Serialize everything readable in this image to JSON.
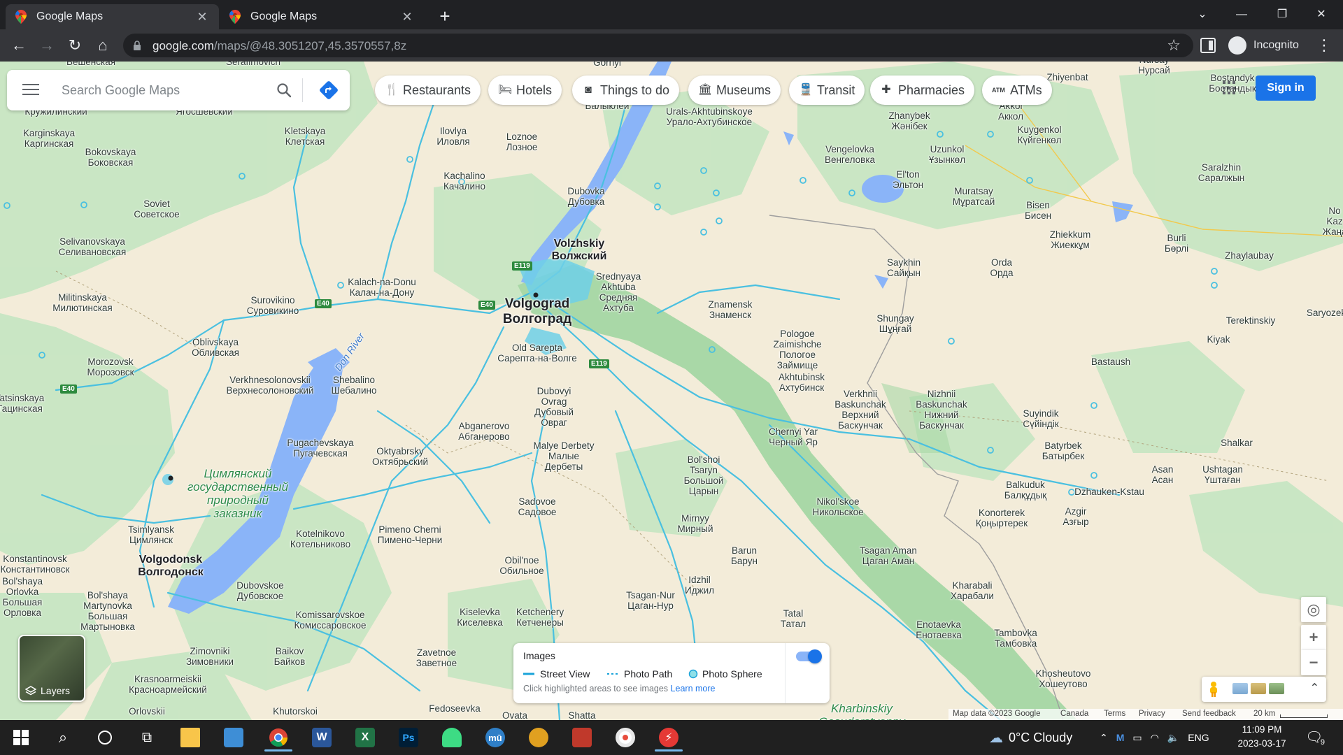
{
  "browser": {
    "tabs": [
      {
        "title": "Google Maps",
        "active": true
      },
      {
        "title": "Google Maps",
        "active": false
      }
    ],
    "new_tab_label": "+",
    "url_host": "google.com",
    "url_path": "/maps/@48.3051207,45.3570557,8z",
    "profile_label": "Incognito"
  },
  "maps": {
    "search_placeholder": "Search Google Maps",
    "chips": [
      {
        "label": "Restaurants",
        "icon": "restaurant-icon"
      },
      {
        "label": "Hotels",
        "icon": "hotel-icon"
      },
      {
        "label": "Things to do",
        "icon": "camera-icon"
      },
      {
        "label": "Museums",
        "icon": "museum-icon"
      },
      {
        "label": "Transit",
        "icon": "transit-icon"
      },
      {
        "label": "Pharmacies",
        "icon": "pharmacy-icon"
      },
      {
        "label": "ATMs",
        "icon": "atm-icon"
      }
    ],
    "signin_label": "Sign in",
    "layers_label": "Layers",
    "zoom_in": "+",
    "zoom_out": "−",
    "images_panel": {
      "title": "Images",
      "street_view": "Street View",
      "photo_path": "Photo Path",
      "photo_sphere": "Photo Sphere",
      "hint": "Click highlighted areas to see images",
      "learn_more": "Learn more",
      "toggle_on": true
    },
    "attribution": {
      "map_data": "Map data ©2023 Google",
      "country": "Canada",
      "terms": "Terms",
      "privacy": "Privacy",
      "feedback": "Send feedback",
      "scale": "20 km"
    },
    "places": [
      {
        "t": "Вешенская",
        "cls": ""
      },
      {
        "t": "Serafimovich",
        "cls": ""
      },
      {
        "t": "Gornyi",
        "cls": ""
      },
      {
        "t": "Nursay\nНурсай",
        "cls": ""
      },
      {
        "t": "Zhiyenbat",
        "cls": ""
      },
      {
        "t": "Bostandyk\nБостандык",
        "cls": ""
      },
      {
        "t": "Кружилинский",
        "cls": ""
      },
      {
        "t": "Ягосшевский",
        "cls": ""
      },
      {
        "t": "Балыклей",
        "cls": ""
      },
      {
        "t": "Urals-Akhtubinskoye\nУрало-Ахтубинское",
        "cls": ""
      },
      {
        "t": "Akkol\nАккол",
        "cls": ""
      },
      {
        "t": "Karginskaya\nКаргинская",
        "cls": ""
      },
      {
        "t": "Kletskaya\nКлетская",
        "cls": ""
      },
      {
        "t": "Ilovlya\nИловля",
        "cls": ""
      },
      {
        "t": "Loznoe\nЛозное",
        "cls": ""
      },
      {
        "t": "Zhanybek\nЖәнібек",
        "cls": ""
      },
      {
        "t": "Kuygenkol\nКүйгенкөл",
        "cls": ""
      },
      {
        "t": "Bokovskaya\nБоковская",
        "cls": ""
      },
      {
        "t": "Kachalino\nКачалино",
        "cls": ""
      },
      {
        "t": "Vengelovka\nВенгеловка",
        "cls": ""
      },
      {
        "t": "Uzunkol\nҰзынкөл",
        "cls": ""
      },
      {
        "t": "El'ton\nЭльтон",
        "cls": ""
      },
      {
        "t": "Saralzhin\nСаралжын",
        "cls": ""
      },
      {
        "t": "Dubovka\nДубовка",
        "cls": ""
      },
      {
        "t": "Muratsay\nМұратсай",
        "cls": ""
      },
      {
        "t": "Bisen\nБисен",
        "cls": ""
      },
      {
        "t": "Soviet\nСоветское",
        "cls": ""
      },
      {
        "t": "Zhiekkum\nЖиеккұм",
        "cls": ""
      },
      {
        "t": "Burli\nБөрлі",
        "cls": ""
      },
      {
        "t": "Zhaylaubay",
        "cls": ""
      },
      {
        "t": "Selivanovskaya\nСеливановская",
        "cls": ""
      },
      {
        "t": "Volzhskiy\nВолжский",
        "cls": "medium"
      },
      {
        "t": "Saykhin\nСайқын",
        "cls": ""
      },
      {
        "t": "Orda\nОрда",
        "cls": ""
      },
      {
        "t": "Kalach-na-Donu\nКалач-на-Дону",
        "cls": ""
      },
      {
        "t": "Srednyaya\nAkhtuba\nСредняя\nАхтуба",
        "cls": ""
      },
      {
        "t": "Militinskaya\nМилютинская",
        "cls": ""
      },
      {
        "t": "Surovikino\nСуровикино",
        "cls": ""
      },
      {
        "t": "Volgograd\nВолгоград",
        "cls": "major"
      },
      {
        "t": "Znamensk\nЗнаменск",
        "cls": ""
      },
      {
        "t": "Shungay\nШұңғай",
        "cls": ""
      },
      {
        "t": "Terektinskiy",
        "cls": ""
      },
      {
        "t": "Saryozek",
        "cls": ""
      },
      {
        "t": "Oblivskaya\nОбливская",
        "cls": ""
      },
      {
        "t": "Pologoe\nZaimishche\nПологое\nЗаймище",
        "cls": ""
      },
      {
        "t": "Kiyak",
        "cls": ""
      },
      {
        "t": "Morozovsk\nМорозовск",
        "cls": ""
      },
      {
        "t": "Old Sarepta\nСарепта-на-Волге",
        "cls": ""
      },
      {
        "t": "Bastaush",
        "cls": ""
      },
      {
        "t": "Verkhnesolonovskii\nВерхнесолоновский",
        "cls": ""
      },
      {
        "t": "Shebalino\nШебалино",
        "cls": ""
      },
      {
        "t": "Akhtubinsk\nАхтубинск",
        "cls": ""
      },
      {
        "t": "Dubovyi\nOvrag\nДубовый\nОвраг",
        "cls": ""
      },
      {
        "t": "Verkhnii\nBaskunchak\nВерхний\nБаскунчак",
        "cls": ""
      },
      {
        "t": "Nizhnii\nBaskunchak\nНижний\nБаскунчак",
        "cls": ""
      },
      {
        "t": "Tatsinskaya\nТацинская",
        "cls": ""
      },
      {
        "t": "Suyindik\nСүйіндік",
        "cls": ""
      },
      {
        "t": "Abganerovo\nАбганерово",
        "cls": ""
      },
      {
        "t": "Pugachevskaya\nПугачевская",
        "cls": ""
      },
      {
        "t": "Oktyabrsky\nОктябрьский",
        "cls": ""
      },
      {
        "t": "Chernyi Yar\nЧерный Яр",
        "cls": ""
      },
      {
        "t": "Batyrbek\nБатырбек",
        "cls": ""
      },
      {
        "t": "Shalkar",
        "cls": ""
      },
      {
        "t": "Malye Derbety\nМалые\nДербеты",
        "cls": ""
      },
      {
        "t": "Bol'shoi\nTsaryn\nБольшой\nЦарын",
        "cls": ""
      },
      {
        "t": "Asan\nАсан",
        "cls": ""
      },
      {
        "t": "Ushtagan\nҮштаған",
        "cls": ""
      },
      {
        "t": "Balkuduk\nБалқұдық",
        "cls": ""
      },
      {
        "t": "Dzhauken-Kstau",
        "cls": ""
      },
      {
        "t": "Sadovoe\nСадовое",
        "cls": ""
      },
      {
        "t": "Nikol'skoe\nНикольское",
        "cls": ""
      },
      {
        "t": "Konorterek\nҚоңыртерек",
        "cls": ""
      },
      {
        "t": "Azgir\nАзғыр",
        "cls": ""
      },
      {
        "t": "Tsimlyansk\nЦимлянск",
        "cls": ""
      },
      {
        "t": "Kotelnikovo\nКотельниково",
        "cls": ""
      },
      {
        "t": "Pimeno Cherni\nПимено-Черни",
        "cls": ""
      },
      {
        "t": "Mirnyy\nМирный",
        "cls": ""
      },
      {
        "t": "Konstantinovsk\nКонстантиновск",
        "cls": ""
      },
      {
        "t": "Volgodonsk\nВолгодонск",
        "cls": "medium"
      },
      {
        "t": "Obil'noe\nОбильное",
        "cls": ""
      },
      {
        "t": "Barun\nБарун",
        "cls": ""
      },
      {
        "t": "Tsagan Aman\nЦаган Аман",
        "cls": ""
      },
      {
        "t": "Bol'shaya\nOrlovka\nБольшая\nОрловка",
        "cls": ""
      },
      {
        "t": "Dubovskoe\nДубовское",
        "cls": ""
      },
      {
        "t": "Idzhil\nИджил",
        "cls": ""
      },
      {
        "t": "Kharabali\nХарабали",
        "cls": ""
      },
      {
        "t": "Bol'shaya\nMartynovka\nБольшая\nМартыновка",
        "cls": ""
      },
      {
        "t": "Tsagan-Nur\nЦаган-Нур",
        "cls": ""
      },
      {
        "t": "Komissarovskoe\nКомиссаровское",
        "cls": ""
      },
      {
        "t": "Kiselevka\nКиселевка",
        "cls": ""
      },
      {
        "t": "Ketchenery\nКетченеры",
        "cls": ""
      },
      {
        "t": "Tatal\nТатал",
        "cls": ""
      },
      {
        "t": "Enotaevka\nЕнотаевка",
        "cls": ""
      },
      {
        "t": "Tambovka\nТамбовка",
        "cls": ""
      },
      {
        "t": "Zimovniki\nЗимовники",
        "cls": ""
      },
      {
        "t": "Baikov\nБайков",
        "cls": ""
      },
      {
        "t": "Zavetnoe\nЗаветное",
        "cls": ""
      },
      {
        "t": "Krasnoarmeiskii\nКрасноармейский",
        "cls": ""
      },
      {
        "t": "Khosheutovo\nХошеутово",
        "cls": ""
      },
      {
        "t": "Orlovskii",
        "cls": ""
      },
      {
        "t": "Khutorskoi",
        "cls": ""
      },
      {
        "t": "Fedoseevka",
        "cls": ""
      },
      {
        "t": "Ovata",
        "cls": ""
      },
      {
        "t": "Shatta",
        "cls": ""
      },
      {
        "t": "Don River",
        "cls": "water"
      },
      {
        "t": "Цимлянский\nгосударственный\nприродный\nзаказник",
        "cls": "park"
      },
      {
        "t": "Kharbinskiy\nGosudarstvenny",
        "cls": "park"
      },
      {
        "t": "No\nKaz\nЖаңа",
        "cls": ""
      }
    ],
    "shields": [
      "E119",
      "E40",
      "E40",
      "E40",
      "E119"
    ]
  },
  "taskbar": {
    "weather_temp": "0°C",
    "weather_desc": "Cloudy",
    "lang": "ENG",
    "time": "11:09 PM",
    "date": "2023-03-17",
    "notifications": "9"
  }
}
